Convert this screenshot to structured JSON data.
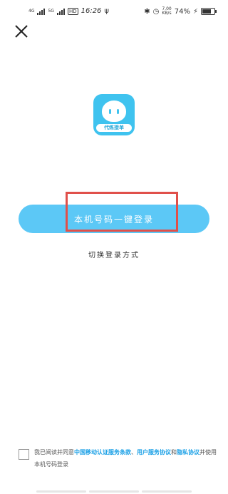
{
  "status_bar": {
    "network_left": "4G",
    "network_right": "5G",
    "hd_badge": "HD",
    "time": "16:26",
    "speed_value": "7.00",
    "speed_unit": "KB/s",
    "battery_percent": "74%",
    "battery_level": 0.74
  },
  "logo": {
    "tag_text": "代练接单"
  },
  "main": {
    "one_click_login_label": "本机号码一键登录",
    "switch_login_label": "切换登录方式"
  },
  "agreement": {
    "prefix": "我已阅读并同意",
    "cmcc_terms": "中国移动认证服务条款",
    "sep": "、",
    "user_terms": "用户服务协议",
    "and": "和",
    "privacy": "隐私协议",
    "suffix": "并使用本机号码登录"
  },
  "colors": {
    "primary": "#5cc8f6",
    "logo_bg": "#3fc3ef",
    "highlight": "#e0504a",
    "link": "#1aa0e6"
  }
}
